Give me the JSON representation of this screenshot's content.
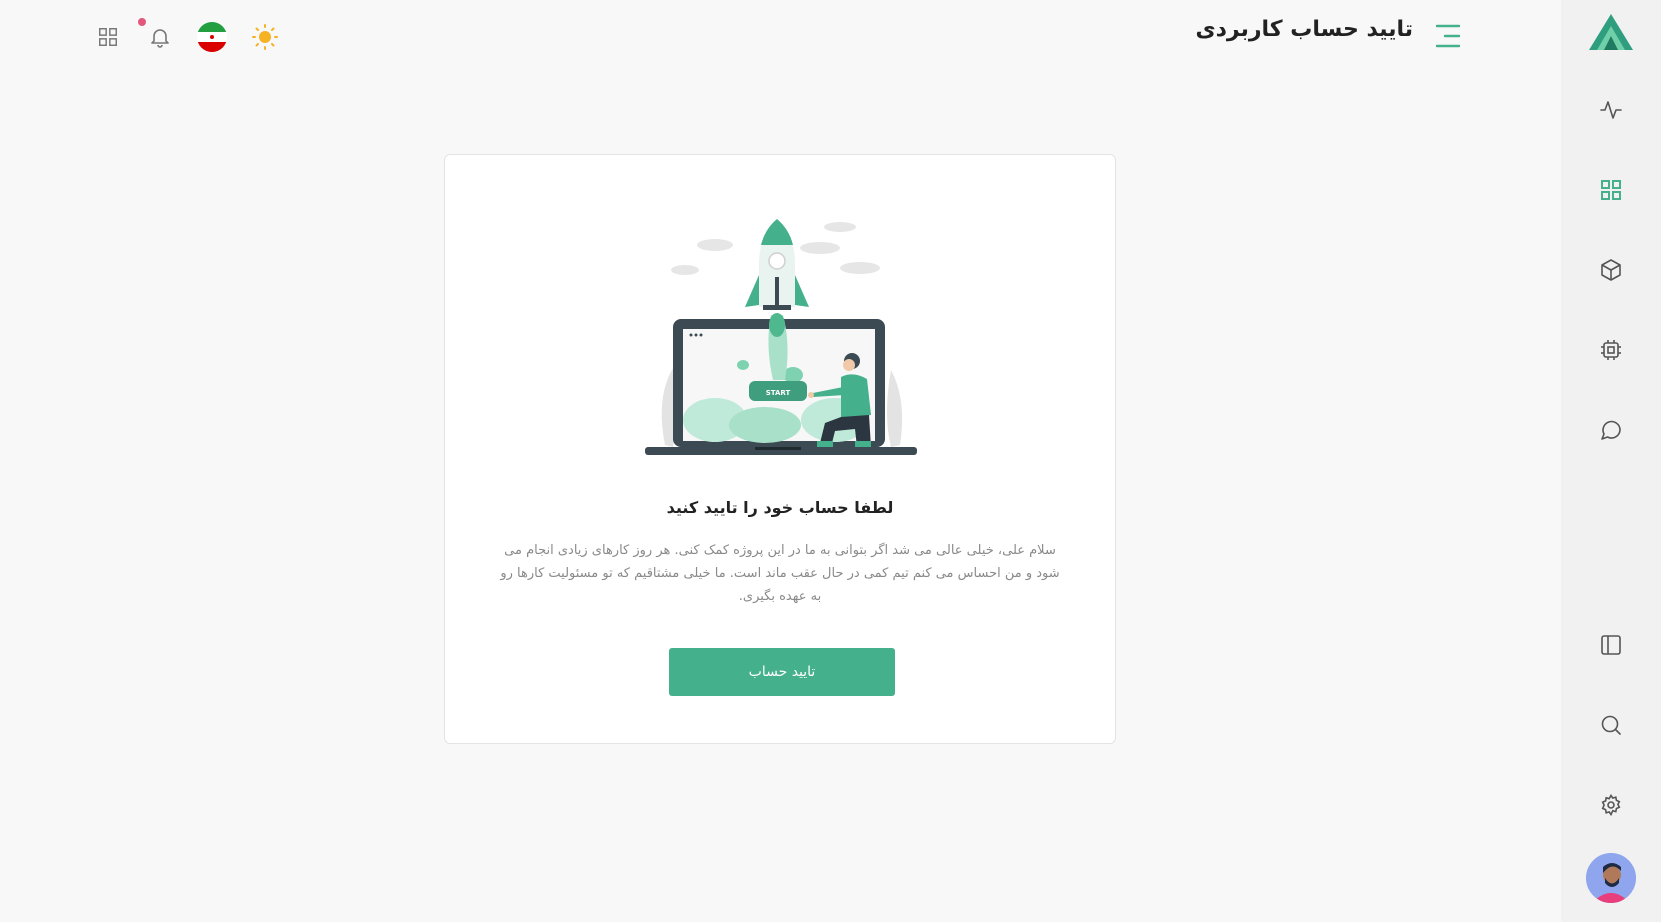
{
  "header": {
    "title": "تایید حساب کاربردی"
  },
  "colors": {
    "accent": "#45b08c",
    "notification_dot": "#e2577a",
    "sun": "#f5b324"
  },
  "header_icons": [
    "apps-grid-icon",
    "bell-icon",
    "iran-flag-icon",
    "sun-icon"
  ],
  "sidebar_icons": [
    "activity-icon",
    "dashboard-grid-icon",
    "box-icon",
    "cpu-icon",
    "chat-icon",
    "layout-panel-icon",
    "search-icon",
    "settings-icon"
  ],
  "card": {
    "illustration_label": "START",
    "title": "لطفا حساب خود را تایید کنید",
    "text": "سلام علی، خیلی عالی می شد اگر بتوانی به ما در این پروژه کمک کنی. هر روز کارهای زیادی انجام می شود و من احساس می کنم تیم کمی در حال عقب ماند است. ما خیلی مشتاقیم که تو مسئولیت کارها رو به عهده بگیری.",
    "button_label": "تایید حساب"
  }
}
